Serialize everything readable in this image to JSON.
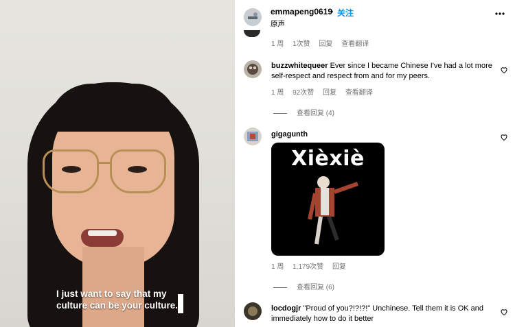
{
  "video": {
    "caption": "I just want to say that my culture can be your culture."
  },
  "header": {
    "username": "emmapeng0619",
    "separator": "•",
    "follow_label": "关注",
    "audio_label": "原声"
  },
  "partial_meta": {
    "time": "1 周",
    "likes": "1次赞",
    "reply": "回复",
    "translate": "查看翻译"
  },
  "comments": [
    {
      "username": "buzzwhitequeer",
      "text": "Ever since I became Chinese I've had a lot more self-respect and respect from and for my peers.",
      "time": "1 周",
      "likes": "92次赞",
      "reply": "回复",
      "translate": "查看翻译",
      "view_replies": "查看回复 (4)"
    },
    {
      "username": "gigagunth",
      "sticker_text": "Xièxiè",
      "time": "1 周",
      "likes": "1,179次赞",
      "reply": "回复",
      "view_replies": "查看回复 (6)"
    },
    {
      "username": "locdogjr",
      "text": "\"Proud of you?!?!?!\" Unchinese. Tell them it is OK and immediately how to do it better"
    }
  ],
  "icons": {
    "heart": "heart-outline-icon",
    "more": "more-horizontal-icon"
  },
  "colors": {
    "accent": "#0095f6",
    "meta": "#737373"
  }
}
